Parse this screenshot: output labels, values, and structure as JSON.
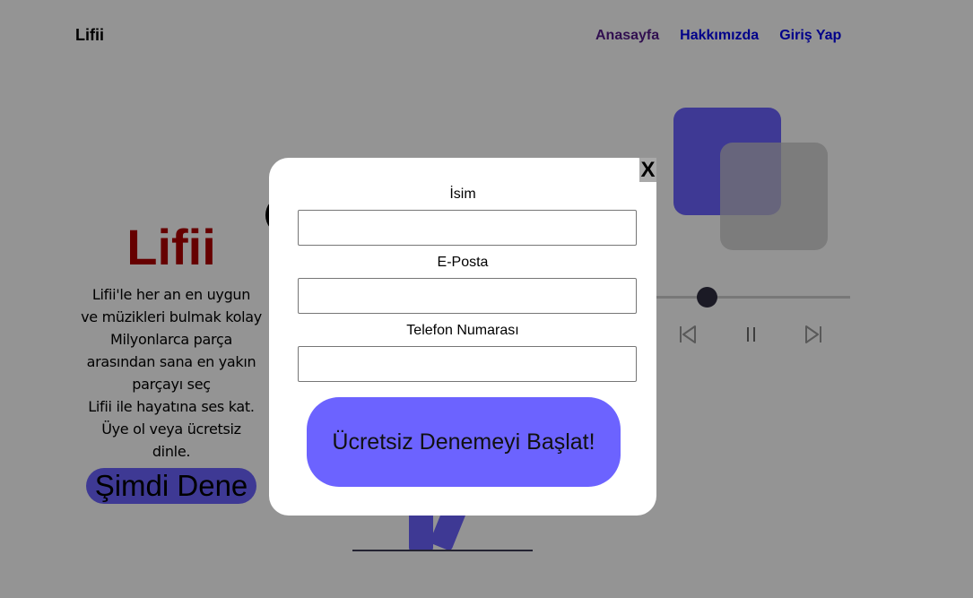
{
  "header": {
    "logo": "Lifii",
    "nav": [
      {
        "label": "Anasayfa"
      },
      {
        "label": "Hakkımızda"
      },
      {
        "label": "Giriş Yap"
      }
    ]
  },
  "hero": {
    "title": "Lifii",
    "lines": [
      "Lifii'le her an en uygun",
      "ve müzikleri bulmak kolay",
      "Milyonlarca parça",
      "arasından sana en yakın",
      "parçayı seç",
      "Lifii ile hayatına ses kat.",
      "Üye ol veya ücretsiz",
      "dinle."
    ],
    "cta_label": "Şimdi Dene"
  },
  "player": {
    "controls": [
      "previous-icon",
      "pause-icon",
      "next-icon"
    ]
  },
  "modal": {
    "close_label": "X",
    "fields": [
      {
        "label": "İsim",
        "value": "",
        "type": "text"
      },
      {
        "label": "E-Posta",
        "value": "",
        "type": "email"
      },
      {
        "label": "Telefon Numarası",
        "value": "",
        "type": "tel"
      }
    ],
    "submit_label": "Ücretsiz Denemeyi Başlat!"
  },
  "colors": {
    "accent": "#6c63ff",
    "hero_title": "#b00000",
    "overlay": "rgba(0,0,0,0.42)"
  }
}
